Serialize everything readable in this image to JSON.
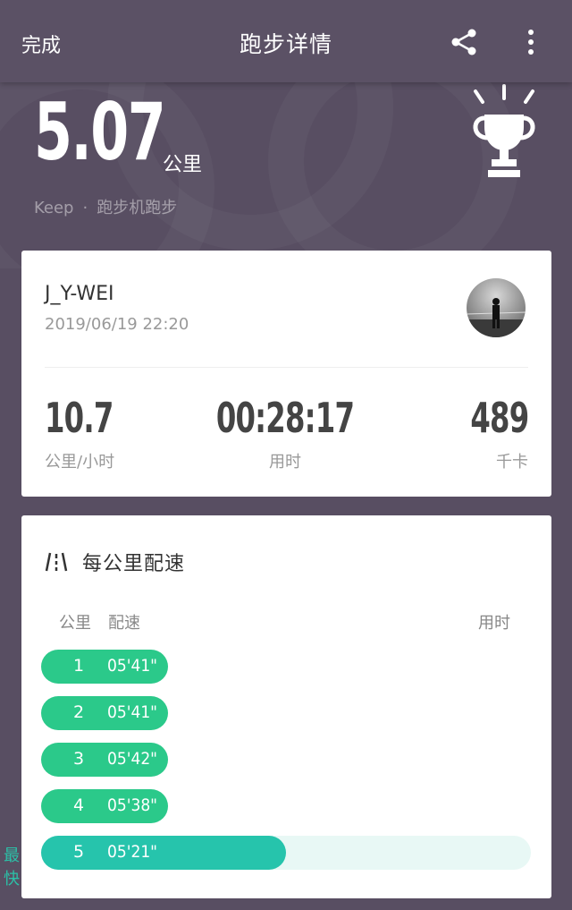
{
  "header": {
    "done_label": "完成",
    "title": "跑步详情",
    "share_icon": "share-icon",
    "more_icon": "more-vertical-icon"
  },
  "hero": {
    "distance": "5.07",
    "distance_unit": "公里",
    "source_app": "Keep",
    "separator": "·",
    "run_type": "跑步机跑步",
    "trophy_icon": "trophy-icon"
  },
  "profile": {
    "username": "J_Y-WEI",
    "datetime": "2019/06/19 22:20",
    "stats": [
      {
        "value": "10.7",
        "label": "公里/小时"
      },
      {
        "value": "00:28:17",
        "label": "用时"
      },
      {
        "value": "489",
        "label": "千卡"
      }
    ]
  },
  "pace": {
    "title": "每公里配速",
    "icon": "road-icon",
    "headers": {
      "km": "公里",
      "pace": "配速",
      "time": "用时"
    },
    "rows": [
      {
        "km": "1",
        "pace": "05'41\"",
        "fill": 0.26,
        "best": ""
      },
      {
        "km": "2",
        "pace": "05'41\"",
        "fill": 0.26,
        "best": ""
      },
      {
        "km": "3",
        "pace": "05'42\"",
        "fill": 0.26,
        "best": ""
      },
      {
        "km": "4",
        "pace": "05'38\"",
        "fill": 0.26,
        "best": ""
      },
      {
        "km": "5",
        "pace": "05'21\"",
        "fill": 0.5,
        "best": "最快"
      }
    ]
  },
  "colors": {
    "background": "#584e62",
    "accent_green": "#2bc98a",
    "fastest_teal": "#26c4ac"
  }
}
